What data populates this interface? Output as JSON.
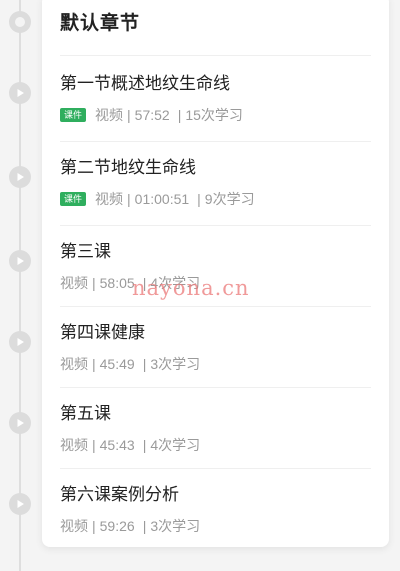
{
  "chapter": {
    "title": "默认章节"
  },
  "lessons": [
    {
      "title": "第一节概述地纹生命线",
      "badge": "课件",
      "type": "视频",
      "duration": "57:52",
      "learners": "15次学习"
    },
    {
      "title": "第二节地纹生命线",
      "badge": "课件",
      "type": "视频",
      "duration": "01:00:51",
      "learners": "9次学习"
    },
    {
      "title": "第三课",
      "badge": "",
      "type": "视频",
      "duration": "58:05",
      "learners": "4次学习"
    },
    {
      "title": "第四课健康",
      "badge": "",
      "type": "视频",
      "duration": "45:49",
      "learners": "3次学习"
    },
    {
      "title": "第五课",
      "badge": "",
      "type": "视频",
      "duration": "45:43",
      "learners": "4次学习"
    },
    {
      "title": "第六课案例分析",
      "badge": "",
      "type": "视频",
      "duration": "59:26",
      "learners": "3次学习"
    }
  ],
  "separator": "|",
  "watermark": "nayona.cn",
  "colors": {
    "badge": "#2fae5e",
    "meta_text": "#9a9a9a",
    "title_text": "#222222",
    "timeline": "#dcdcdc"
  },
  "icons": {
    "timeline_node": "play-circle-icon"
  }
}
